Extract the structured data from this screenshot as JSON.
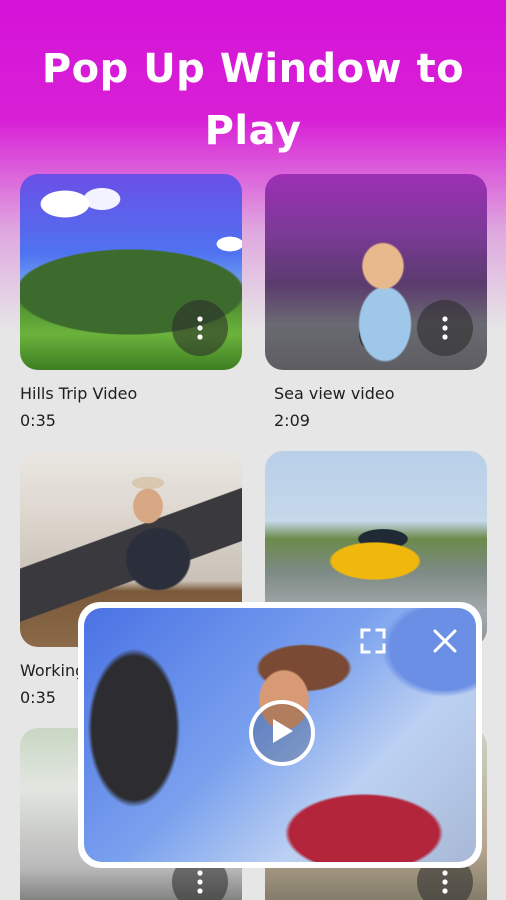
{
  "header": {
    "line1": "Pop Up Window to",
    "line2": "Play"
  },
  "videos": [
    {
      "title": "Hills Trip Video",
      "duration": "0:35"
    },
    {
      "title": "Sea view video",
      "duration": "2:09"
    },
    {
      "title": "Working",
      "duration": "0:35"
    },
    {
      "title": "",
      "duration": ""
    }
  ],
  "icons": {
    "more": "more-vertical-icon",
    "fullscreen": "fullscreen-icon",
    "close": "close-icon",
    "play": "play-icon"
  },
  "colors": {
    "brand_magenta": "#d512d8",
    "background_gray": "#e6e6e6"
  }
}
